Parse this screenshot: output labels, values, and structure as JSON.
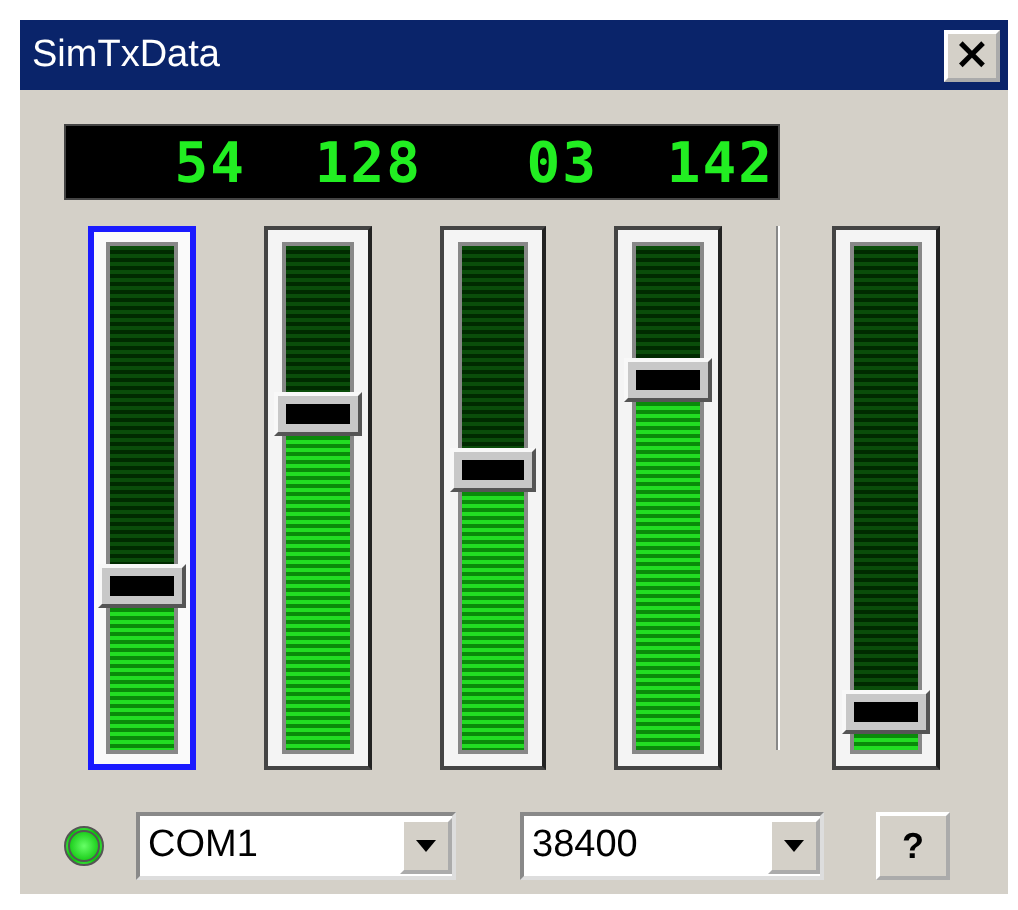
{
  "window": {
    "title": "SimTxData",
    "close": "×"
  },
  "readouts": [
    "54",
    "128",
    "03",
    "142"
  ],
  "sliders": [
    {
      "level": 0.29,
      "selected": true
    },
    {
      "level": 0.63,
      "selected": false
    },
    {
      "level": 0.52,
      "selected": false
    },
    {
      "level": 0.7,
      "selected": false
    },
    {
      "level": 0.04,
      "selected": false
    }
  ],
  "status_led": {
    "on": true
  },
  "port": {
    "value": "COM1"
  },
  "baud": {
    "value": "38400"
  },
  "help_button": "?"
}
